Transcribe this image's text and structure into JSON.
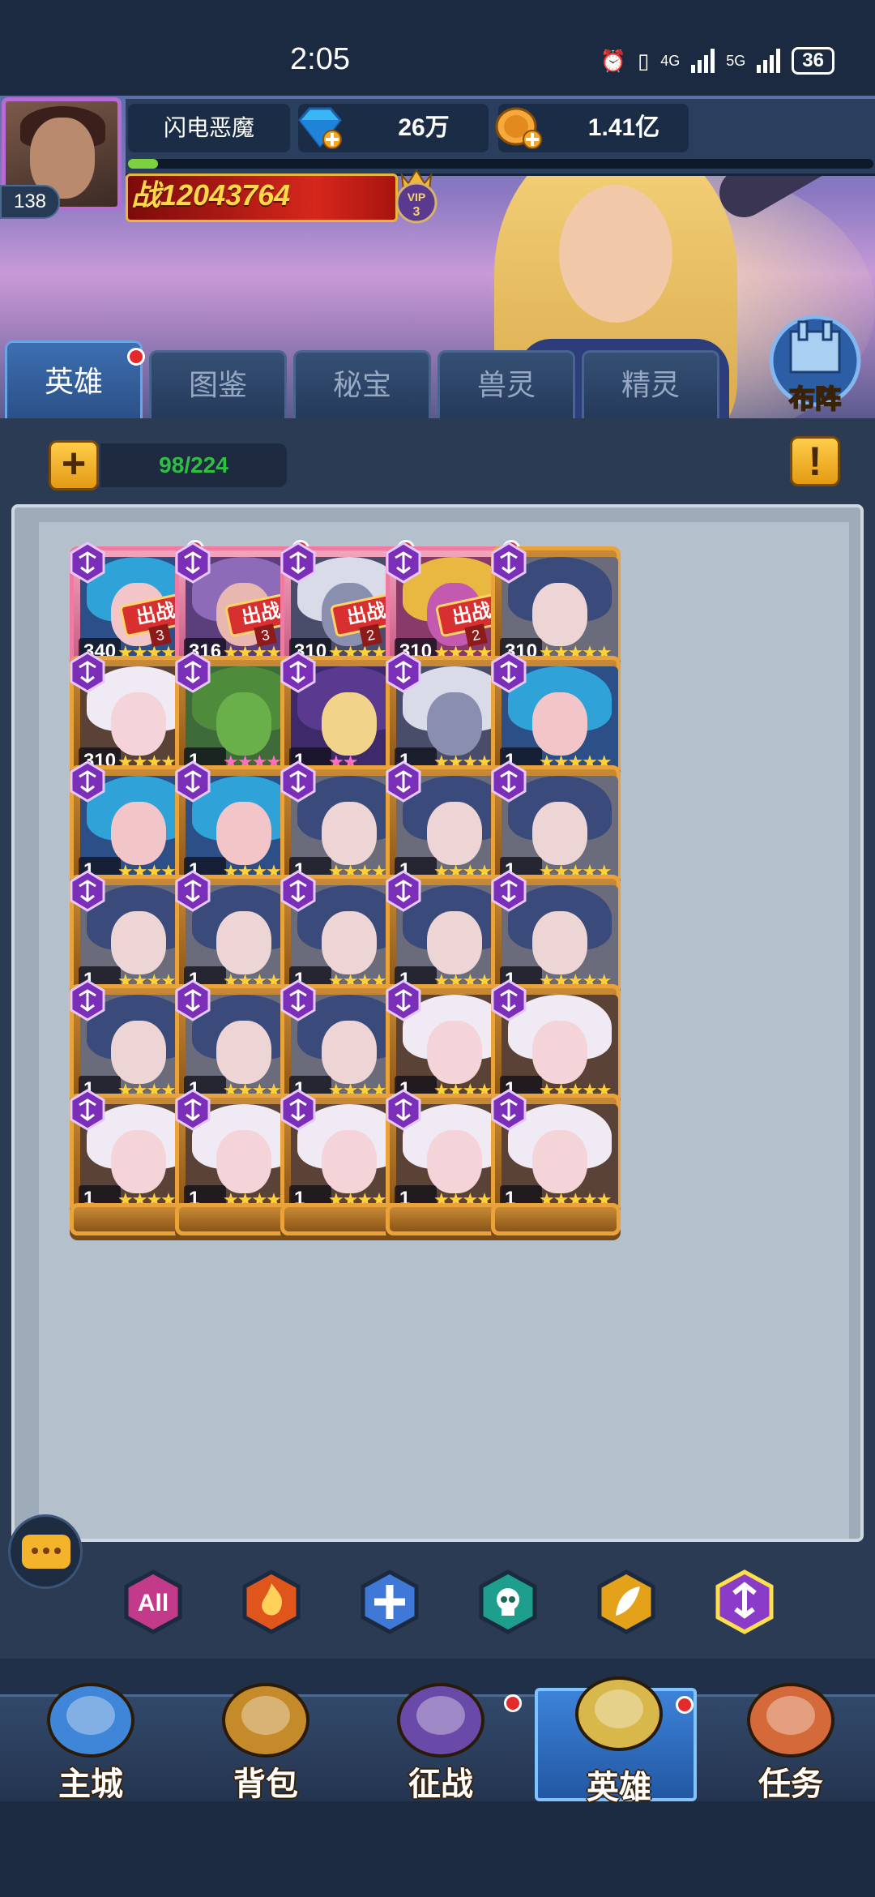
{
  "status_bar": {
    "time": "2:05",
    "network_1": "4G",
    "network_2": "5G",
    "battery": "36"
  },
  "player": {
    "name": "闪电恶魔",
    "level": "138",
    "power": "战12043764",
    "vip": "VIP 3",
    "exp_fraction": 0.04
  },
  "resources": {
    "gems": "26万",
    "gold": "1.41亿"
  },
  "formation_button": "布阵",
  "tabs": [
    {
      "label": "英雄",
      "active": true,
      "badge": true
    },
    {
      "label": "图鉴",
      "active": false,
      "badge": false
    },
    {
      "label": "秘宝",
      "active": false,
      "badge": false
    },
    {
      "label": "兽灵",
      "active": false,
      "badge": false
    },
    {
      "label": "精灵",
      "active": false,
      "badge": false
    }
  ],
  "hero_count": "98/224",
  "deploy_label": "出战",
  "heroes": [
    {
      "level": "340",
      "stars": 5,
      "frame": "pink",
      "deployed": "3",
      "badge": true,
      "art": "blue-hair"
    },
    {
      "level": "316",
      "stars": 5,
      "frame": "pink",
      "deployed": "3",
      "badge": true,
      "art": "horned"
    },
    {
      "level": "310",
      "stars": 5,
      "frame": "pink",
      "deployed": "2",
      "badge": true,
      "art": "silver-dark"
    },
    {
      "level": "310",
      "stars": 5,
      "frame": "pink",
      "deployed": "2",
      "badge": true,
      "art": "pink-horned"
    },
    {
      "level": "310",
      "stars": 5,
      "frame": "gold",
      "deployed": "",
      "badge": false,
      "art": "masked"
    },
    {
      "level": "310",
      "stars": 5,
      "frame": "gold",
      "deployed": "",
      "badge": false,
      "art": "elf"
    },
    {
      "level": "1",
      "stars": 4,
      "frame": "gold",
      "deployed": "",
      "badge": false,
      "art": "toad",
      "star_color": "pink"
    },
    {
      "level": "1",
      "stars": 2,
      "frame": "gold",
      "deployed": "",
      "badge": false,
      "art": "guyfawkes",
      "star_color": "pink"
    },
    {
      "level": "1",
      "stars": 5,
      "frame": "gold",
      "deployed": "",
      "badge": false,
      "art": "silver-dark"
    },
    {
      "level": "1",
      "stars": 5,
      "frame": "gold",
      "deployed": "",
      "badge": false,
      "art": "blue-hair"
    },
    {
      "level": "1",
      "stars": 5,
      "frame": "gold",
      "deployed": "",
      "badge": false,
      "art": "blue-hair"
    },
    {
      "level": "1",
      "stars": 5,
      "frame": "gold",
      "deployed": "",
      "badge": false,
      "art": "blue-hair"
    },
    {
      "level": "1",
      "stars": 5,
      "frame": "gold",
      "deployed": "",
      "badge": false,
      "art": "masked"
    },
    {
      "level": "1",
      "stars": 5,
      "frame": "gold",
      "deployed": "",
      "badge": false,
      "art": "masked"
    },
    {
      "level": "1",
      "stars": 5,
      "frame": "gold",
      "deployed": "",
      "badge": false,
      "art": "masked"
    },
    {
      "level": "1",
      "stars": 5,
      "frame": "gold",
      "deployed": "",
      "badge": false,
      "art": "masked"
    },
    {
      "level": "1",
      "stars": 5,
      "frame": "gold",
      "deployed": "",
      "badge": false,
      "art": "masked"
    },
    {
      "level": "1",
      "stars": 5,
      "frame": "gold",
      "deployed": "",
      "badge": false,
      "art": "masked"
    },
    {
      "level": "1",
      "stars": 5,
      "frame": "gold",
      "deployed": "",
      "badge": false,
      "art": "masked"
    },
    {
      "level": "1",
      "stars": 5,
      "frame": "gold",
      "deployed": "",
      "badge": false,
      "art": "masked"
    },
    {
      "level": "1",
      "stars": 5,
      "frame": "gold",
      "deployed": "",
      "badge": false,
      "art": "masked"
    },
    {
      "level": "1",
      "stars": 5,
      "frame": "gold",
      "deployed": "",
      "badge": false,
      "art": "masked"
    },
    {
      "level": "1",
      "stars": 5,
      "frame": "gold",
      "deployed": "",
      "badge": false,
      "art": "masked"
    },
    {
      "level": "1",
      "stars": 5,
      "frame": "gold",
      "deployed": "",
      "badge": false,
      "art": "elf"
    },
    {
      "level": "1",
      "stars": 5,
      "frame": "gold",
      "deployed": "",
      "badge": false,
      "art": "elf"
    },
    {
      "level": "1",
      "stars": 5,
      "frame": "gold",
      "deployed": "",
      "badge": false,
      "art": "elf"
    },
    {
      "level": "1",
      "stars": 5,
      "frame": "gold",
      "deployed": "",
      "badge": false,
      "art": "elf"
    },
    {
      "level": "1",
      "stars": 5,
      "frame": "gold",
      "deployed": "",
      "badge": false,
      "art": "elf"
    },
    {
      "level": "1",
      "stars": 5,
      "frame": "gold",
      "deployed": "",
      "badge": false,
      "art": "elf"
    },
    {
      "level": "1",
      "stars": 5,
      "frame": "gold",
      "deployed": "",
      "badge": false,
      "art": "elf"
    }
  ],
  "filters": [
    {
      "name": "all",
      "label": "All",
      "color": "#c43a8a"
    },
    {
      "name": "fire",
      "label": "",
      "color": "#e0551c"
    },
    {
      "name": "holy",
      "label": "",
      "color": "#3f78d6"
    },
    {
      "name": "undead",
      "label": "",
      "color": "#1e9e8c"
    },
    {
      "name": "nature",
      "label": "",
      "color": "#e3a21a"
    },
    {
      "name": "dark",
      "label": "",
      "color": "#8a3bc8"
    }
  ],
  "bottom_nav": [
    {
      "label": "主城",
      "active": false,
      "badge": false
    },
    {
      "label": "背包",
      "active": false,
      "badge": false
    },
    {
      "label": "征战",
      "active": false,
      "badge": true
    },
    {
      "label": "英雄",
      "active": true,
      "badge": true
    },
    {
      "label": "任务",
      "active": false,
      "badge": false
    }
  ]
}
